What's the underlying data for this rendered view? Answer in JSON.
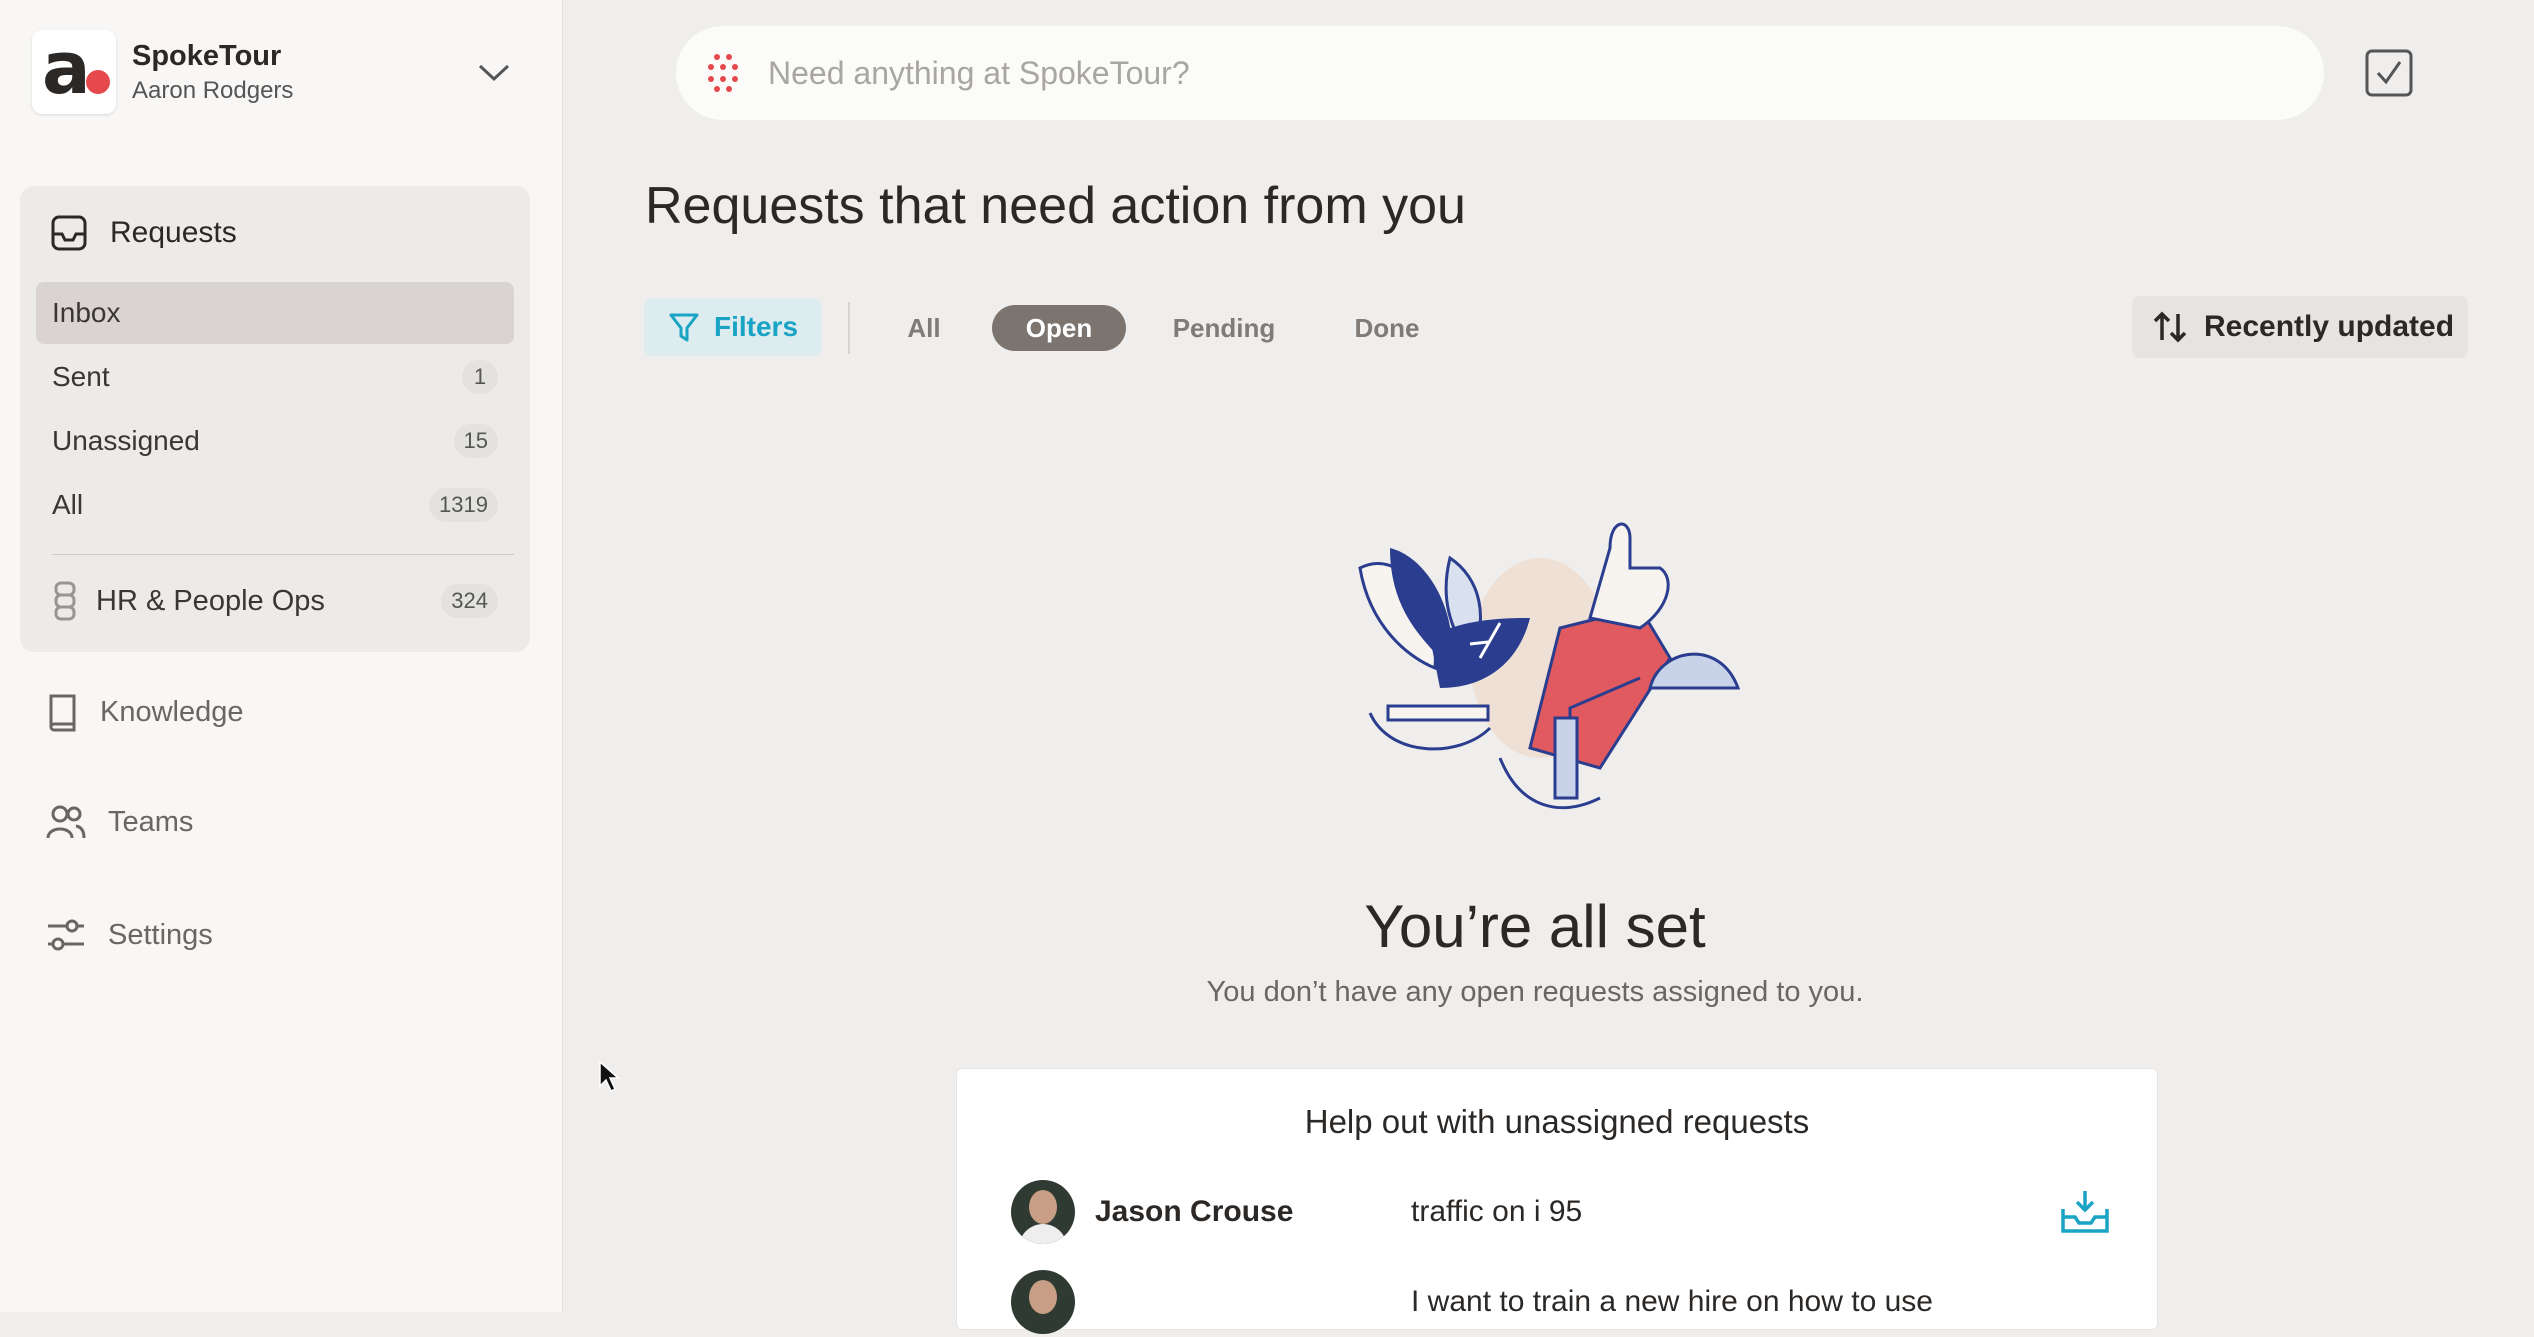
{
  "workspace": {
    "name": "SpokeTour",
    "user": "Aaron Rodgers"
  },
  "requests": {
    "label": "Requests",
    "items": [
      {
        "label": "Inbox",
        "count": ""
      },
      {
        "label": "Sent",
        "count": "1"
      },
      {
        "label": "Unassigned",
        "count": "15"
      },
      {
        "label": "All",
        "count": "1319"
      }
    ],
    "team": {
      "label": "HR & People Ops",
      "count": "324"
    }
  },
  "nav": {
    "knowledge": "Knowledge",
    "teams": "Teams",
    "settings": "Settings"
  },
  "search": {
    "placeholder": "Need anything at SpokeTour?"
  },
  "main": {
    "title": "Requests that need action from you",
    "filters_label": "Filters",
    "tabs": [
      "All",
      "Open",
      "Pending",
      "Done"
    ],
    "active_tab": "Open",
    "sort_label": "Recently updated",
    "empty_title": "You’re all set",
    "empty_subtitle": "You don’t have any open requests assigned to you."
  },
  "unassigned_card": {
    "title": "Help out with unassigned requests",
    "rows": [
      {
        "name": "Jason Crouse",
        "text": "traffic on i 95"
      },
      {
        "name": "",
        "text": "I want to train a new hire on how to use"
      }
    ]
  },
  "colors": {
    "accent": "#19a3c4",
    "brand_red": "#e5484d",
    "active_pill": "#7b746f"
  }
}
